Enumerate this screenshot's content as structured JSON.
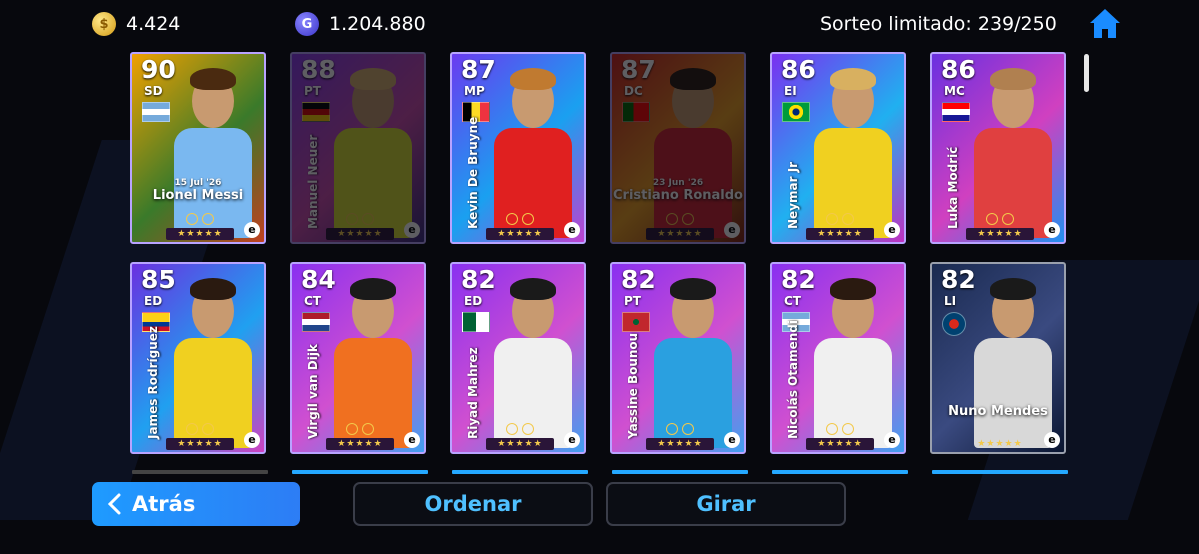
{
  "header": {
    "coins": "4.424",
    "gp": "1.204.880",
    "draw_info": "Sorteo limitado: 239/250"
  },
  "cards": [
    {
      "rating": "90",
      "position": "SD",
      "name": "Lionel Messi",
      "date": "15 Jul '26",
      "name_style": "horizontal",
      "dim": false,
      "flag": "argentina",
      "stars": "★★★★★",
      "bg": [
        "#f0a000",
        "#3a7a2a",
        "#c04020"
      ],
      "kit": "#7ab8f0",
      "hair": "#4a2a10"
    },
    {
      "rating": "88",
      "position": "PT",
      "name": "Manuel Neuer",
      "date": "",
      "name_style": "vertical",
      "dim": true,
      "flag": "germany",
      "stars": "★★★★★",
      "bg": [
        "#8a3af0",
        "#d04ab0",
        "#3a2a80"
      ],
      "kit": "#d8e030",
      "hair": "#d8b070"
    },
    {
      "rating": "87",
      "position": "MP",
      "name": "Kevin De Bruyne",
      "date": "",
      "name_style": "vertical",
      "dim": false,
      "flag": "belgium",
      "stars": "★★★★★",
      "bg": [
        "#6a3af0",
        "#1aa0f0",
        "#c040d0"
      ],
      "kit": "#e02020",
      "hair": "#c07a30"
    },
    {
      "rating": "87",
      "position": "DC",
      "name": "Cristiano Ronaldo",
      "date": "23 Jun '26",
      "name_style": "horizontal",
      "dim": true,
      "flag": "portugal",
      "stars": "★★★★★",
      "bg": [
        "#d02020",
        "#f0a020",
        "#802010"
      ],
      "kit": "#d02030",
      "hair": "#2a1a10"
    },
    {
      "rating": "86",
      "position": "EI",
      "name": "Neymar Jr",
      "date": "",
      "name_style": "vertical",
      "dim": false,
      "flag": "brazil",
      "stars": "★★★★★",
      "bg": [
        "#7a30f0",
        "#20b0f0",
        "#c030c0"
      ],
      "kit": "#f0d020",
      "hair": "#d8b060"
    },
    {
      "rating": "86",
      "position": "MC",
      "name": "Luka Modrić",
      "date": "",
      "name_style": "vertical",
      "dim": false,
      "flag": "croatia",
      "stars": "★★★★★",
      "bg": [
        "#6a30e0",
        "#d040c0",
        "#2090f0"
      ],
      "kit": "#e04040",
      "hair": "#b08050"
    },
    {
      "rating": "85",
      "position": "ED",
      "name": "James Rodríguez",
      "date": "",
      "name_style": "vertical",
      "dim": false,
      "flag": "colombia",
      "stars": "★★★★★",
      "bg": [
        "#6a30e0",
        "#20a0f0",
        "#d040c0"
      ],
      "kit": "#f0d020",
      "hair": "#2a1a10"
    },
    {
      "rating": "84",
      "position": "CT",
      "name": "Virgil van Dijk",
      "date": "",
      "name_style": "vertical",
      "dim": false,
      "flag": "netherlands",
      "stars": "★★★★★",
      "bg": [
        "#8a30f0",
        "#d050d0",
        "#40a0f0"
      ],
      "kit": "#f07020",
      "hair": "#1a1a1a"
    },
    {
      "rating": "82",
      "position": "ED",
      "name": "Riyad Mahrez",
      "date": "",
      "name_style": "vertical",
      "dim": false,
      "flag": "algeria",
      "stars": "★★★★★",
      "bg": [
        "#8a30f0",
        "#d050d0",
        "#40a0f0"
      ],
      "kit": "#f0f0f0",
      "hair": "#1a1a1a"
    },
    {
      "rating": "82",
      "position": "PT",
      "name": "Yassine Bounou",
      "date": "",
      "name_style": "vertical",
      "dim": false,
      "flag": "morocco",
      "stars": "★★★★★",
      "bg": [
        "#8a30f0",
        "#d050d0",
        "#40a0f0"
      ],
      "kit": "#2aa0e0",
      "hair": "#1a1a1a"
    },
    {
      "rating": "82",
      "position": "CT",
      "name": "Nicolás Otamendi",
      "date": "",
      "name_style": "vertical",
      "dim": false,
      "flag": "argentina",
      "stars": "★★★★★",
      "bg": [
        "#8a30f0",
        "#d050d0",
        "#40a0f0"
      ],
      "kit": "#f0f0f0",
      "hair": "#2a1a10"
    },
    {
      "rating": "82",
      "position": "LI",
      "name": "Nuno Mendes",
      "date": "",
      "name_style": "club",
      "dim": false,
      "flag": "psg",
      "stars": "★★★★★",
      "bg": [
        "#1a2a50",
        "#3a4a80",
        "#0a1530"
      ],
      "kit": "#d8d8d8",
      "hair": "#1a1a1a"
    }
  ],
  "buttons": {
    "back": "Atrás",
    "sort": "Ordenar",
    "spin": "Girar"
  },
  "colors": {
    "accent_blue": "#1e9bff",
    "outline_text": "#4fc0ff",
    "home_icon": "#1a8cff"
  }
}
